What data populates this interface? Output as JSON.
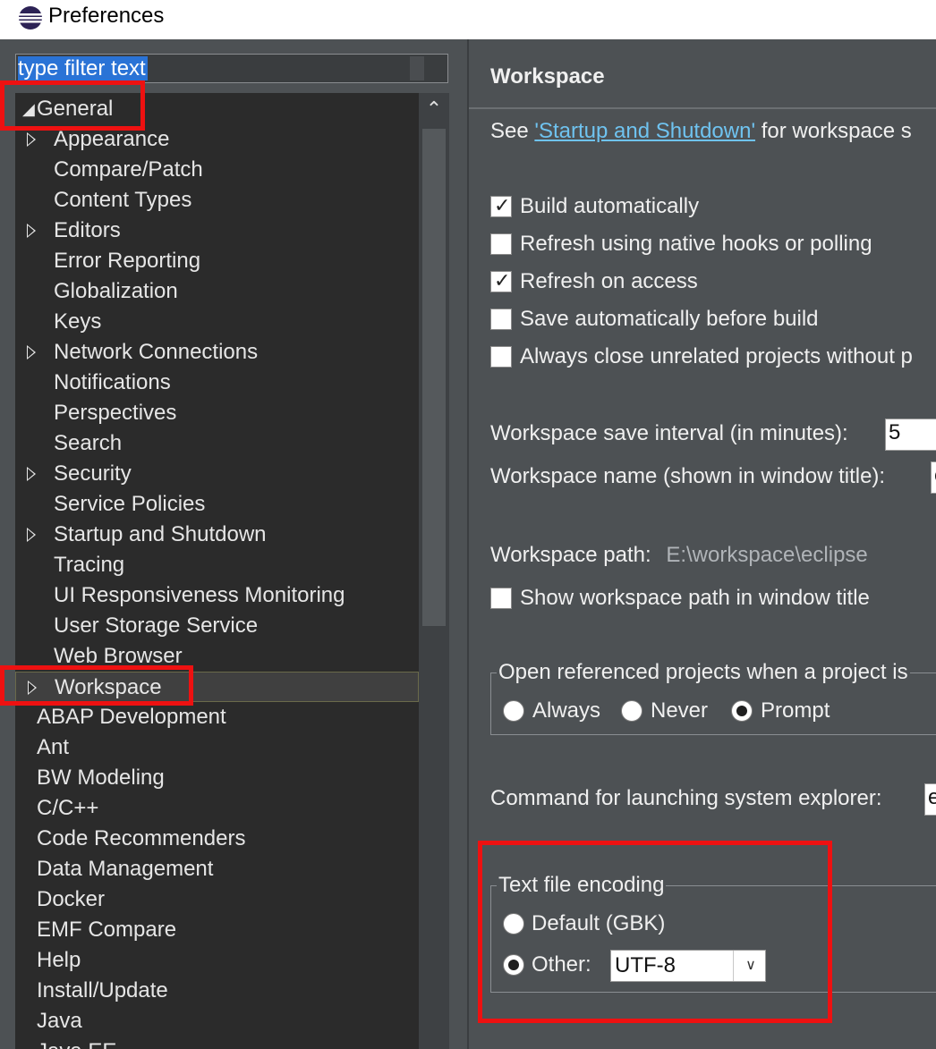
{
  "window": {
    "title": "Preferences"
  },
  "filter": {
    "text": "type filter text"
  },
  "tree": {
    "general": "General",
    "general_children": [
      {
        "label": "Appearance",
        "expandable": true
      },
      {
        "label": "Compare/Patch",
        "expandable": false
      },
      {
        "label": "Content Types",
        "expandable": false
      },
      {
        "label": "Editors",
        "expandable": true
      },
      {
        "label": "Error Reporting",
        "expandable": false
      },
      {
        "label": "Globalization",
        "expandable": false
      },
      {
        "label": "Keys",
        "expandable": false
      },
      {
        "label": "Network Connections",
        "expandable": true
      },
      {
        "label": "Notifications",
        "expandable": false
      },
      {
        "label": "Perspectives",
        "expandable": false
      },
      {
        "label": "Search",
        "expandable": false
      },
      {
        "label": "Security",
        "expandable": true
      },
      {
        "label": "Service Policies",
        "expandable": false
      },
      {
        "label": "Startup and Shutdown",
        "expandable": true
      },
      {
        "label": "Tracing",
        "expandable": false
      },
      {
        "label": "UI Responsiveness Monitoring",
        "expandable": false
      },
      {
        "label": "User Storage Service",
        "expandable": false
      },
      {
        "label": "Web Browser",
        "expandable": false
      },
      {
        "label": "Workspace",
        "expandable": true,
        "selected": true
      }
    ],
    "top_level": [
      "ABAP Development",
      "Ant",
      "BW Modeling",
      "C/C++",
      "Code Recommenders",
      "Data Management",
      "Docker",
      "EMF Compare",
      "Help",
      "Install/Update",
      "Java",
      "Java EE"
    ]
  },
  "page": {
    "title": "Workspace",
    "see_prefix": "See",
    "see_link": "'Startup and Shutdown'",
    "see_suffix": "for workspace s",
    "checkboxes": [
      {
        "label": "Build automatically",
        "checked": true
      },
      {
        "label": "Refresh using native hooks or polling",
        "checked": false
      },
      {
        "label": "Refresh on access",
        "checked": true
      },
      {
        "label": "Save automatically before build",
        "checked": false
      },
      {
        "label": "Always close unrelated projects without p",
        "checked": false
      }
    ],
    "save_interval_label": "Workspace save interval (in minutes):",
    "save_interval_value": "5",
    "ws_name_label": "Workspace name (shown in window title):",
    "ws_name_value": "e",
    "ws_path_label": "Workspace path:",
    "ws_path_value": "E:\\workspace\\eclipse",
    "show_path_label": "Show workspace path in window title",
    "show_path_checked": false,
    "open_ref_group": "Open referenced projects when a project is",
    "open_ref_options": [
      {
        "label": "Always",
        "selected": false
      },
      {
        "label": "Never",
        "selected": false
      },
      {
        "label": "Prompt",
        "selected": true
      }
    ],
    "cmd_label": "Command for launching system explorer:",
    "cmd_value": "e",
    "encoding_group": "Text file encoding",
    "encoding_default": "Default (GBK)",
    "encoding_other": "Other:",
    "encoding_value": "UTF-8"
  },
  "colors": {
    "highlight_box": "#ee1111",
    "link": "#6fc3f0",
    "filter_selection": "#2a73d6"
  }
}
